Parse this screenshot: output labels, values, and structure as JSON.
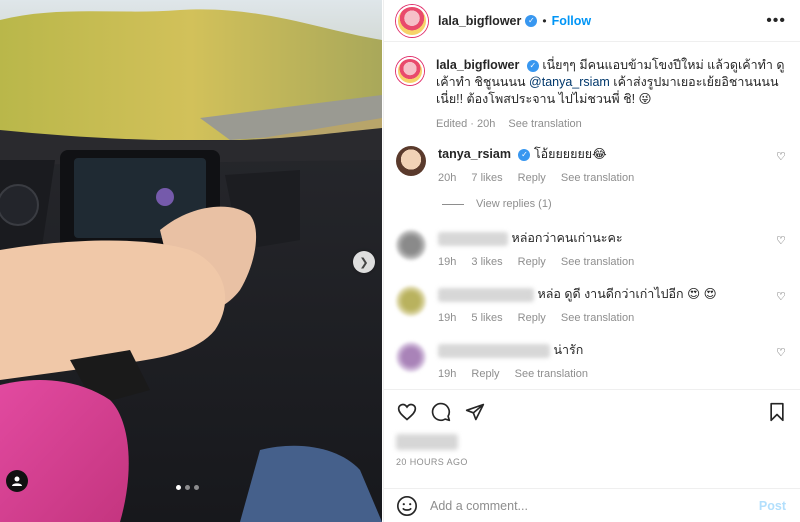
{
  "post": {
    "username": "lala_bigflower",
    "follow_label": "Follow",
    "separator": "•",
    "more_label": "•••",
    "caption_text": "เนี่ยๆๆ มีคนแอบข้ามโขงปีใหม่ แล้วดูเค้าทำ ดูเค้าทำ ชิชูนนนน",
    "caption_mention": "@tanya_rsiam",
    "caption_text2": "เค้าส่งรูปมาเยอะเย้ยอิชานนนน เนี่ย!! ต้องโพสประจาน ไปไม่ชวนพี่ ชิ! 😜",
    "edited_label": "Edited · 20h",
    "see_translation": "See translation",
    "time_ago": "20 HOURS AGO",
    "add_comment_placeholder": "Add a comment...",
    "post_label": "Post"
  },
  "comments": [
    {
      "user": "tanya_rsiam",
      "verified": true,
      "text": "โอ้ยยยยยย😂",
      "time": "20h",
      "likes": "7 likes",
      "reply": "Reply",
      "translate": "See translation",
      "avatar": "tanya"
    },
    {
      "user": "",
      "verified": false,
      "text": "หล่อกว่าคนเก่านะคะ",
      "time": "19h",
      "likes": "3 likes",
      "reply": "Reply",
      "translate": "See translation",
      "avatar": "blur1"
    },
    {
      "user": "",
      "verified": false,
      "text": "หล่อ ดูดี งานดีกว่าเก่าไปอีก 😍 😍",
      "time": "19h",
      "likes": "5 likes",
      "reply": "Reply",
      "translate": "See translation",
      "avatar": "blur2"
    },
    {
      "user": "",
      "verified": false,
      "text": "น่ารัก",
      "time": "19h",
      "likes": "",
      "reply": "Reply",
      "translate": "See translation",
      "avatar": "blur3"
    }
  ],
  "view_replies": "View replies (1)",
  "carousel": {
    "current": 1,
    "total": 3
  },
  "icons": {
    "like": "heart-icon",
    "comment": "comment-icon",
    "share": "share-icon",
    "save": "bookmark-icon",
    "emoji": "emoji-icon",
    "next": "chevron-right-icon",
    "tag": "user-tag-icon"
  },
  "colors": {
    "accent": "#0095f6",
    "verified": "#3897f0",
    "muted": "#8e8e8e",
    "post_disabled": "#b2dffc"
  }
}
